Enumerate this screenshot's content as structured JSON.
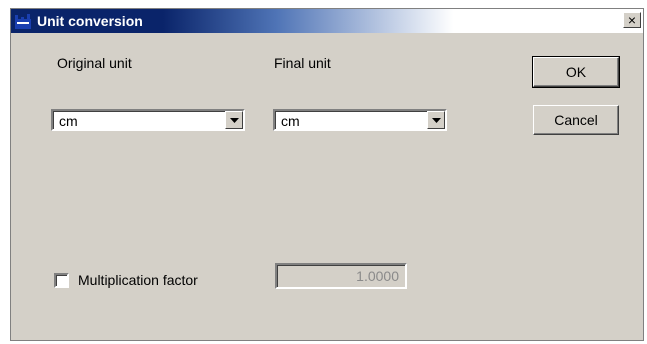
{
  "window": {
    "title": "Unit conversion",
    "close_symbol": "×"
  },
  "labels": {
    "original_unit": "Original unit",
    "final_unit": "Final unit",
    "multiplication_factor": "Multiplication factor"
  },
  "original_unit_select": {
    "selected": "cm"
  },
  "final_unit_select": {
    "selected": "cm"
  },
  "multiplication_factor": {
    "value": "1.0000",
    "checked": false
  },
  "buttons": {
    "ok": "OK",
    "cancel": "Cancel"
  },
  "icons": [
    "app-icon",
    "close-icon",
    "dropdown-arrow-icon"
  ],
  "colors": {
    "titlebar_active": "#0a246a",
    "dialog_face": "#d4d0c8"
  }
}
